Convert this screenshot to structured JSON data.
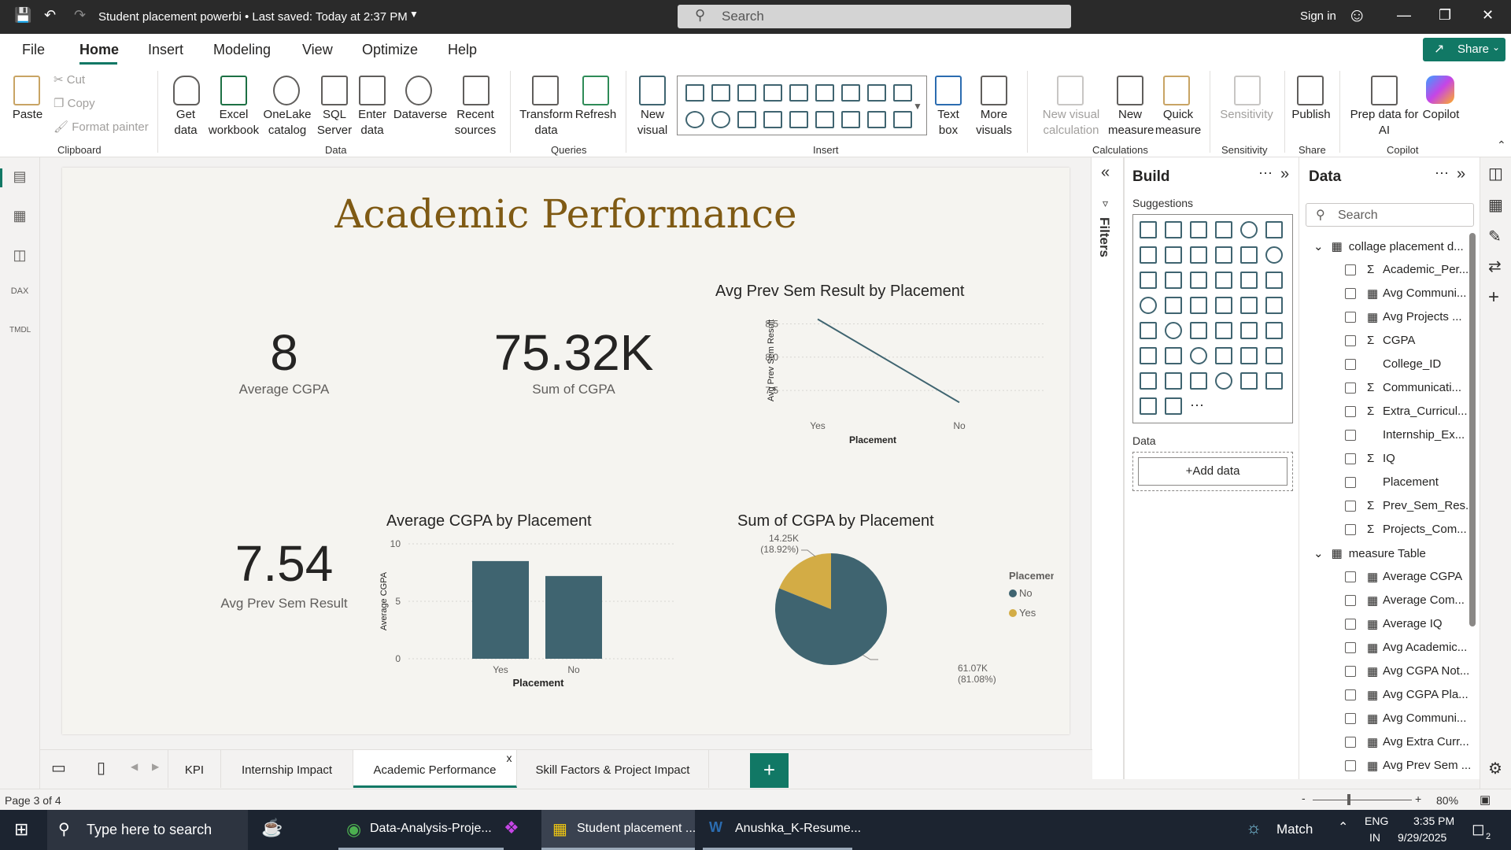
{
  "titlebar": {
    "doc_title": "Student placement powerbi • Last saved: Today at 2:37 PM",
    "search_placeholder": "Search",
    "signin": "Sign in"
  },
  "menu": {
    "items": [
      "File",
      "Home",
      "Insert",
      "Modeling",
      "View",
      "Optimize",
      "Help"
    ],
    "active": "Home",
    "share": "Share"
  },
  "ribbon": {
    "clipboard": {
      "paste": "Paste",
      "cut": "Cut",
      "copy": "Copy",
      "format_painter": "Format painter",
      "group": "Clipboard"
    },
    "data": {
      "get_data": "Get data",
      "excel": "Excel workbook",
      "onelake": "OneLake catalog",
      "sql": "SQL Server",
      "enter": "Enter data",
      "dataverse": "Dataverse",
      "recent": "Recent sources",
      "group": "Data"
    },
    "queries": {
      "transform": "Transform data",
      "refresh": "Refresh",
      "group": "Queries"
    },
    "insert": {
      "new_visual": "New visual",
      "text_box": "Text box",
      "more_visuals": "More visuals",
      "group": "Insert"
    },
    "calculations": {
      "new_visual_calc": "New visual calculation",
      "new_measure": "New measure",
      "quick_measure": "Quick measure",
      "group": "Calculations"
    },
    "sensitivity": {
      "label": "Sensitivity",
      "group": "Sensitivity"
    },
    "share": {
      "publish": "Publish",
      "group": "Share"
    },
    "copilot": {
      "prep": "Prep data for AI",
      "copilot": "Copilot",
      "group": "Copilot"
    }
  },
  "report": {
    "title": "Academic Performance",
    "kpis": [
      {
        "value": "8",
        "label": "Average CGPA"
      },
      {
        "value": "75.32K",
        "label": "Sum of CGPA"
      },
      {
        "value": "7.54",
        "label": "Avg Prev Sem Result"
      }
    ]
  },
  "chart_data": [
    {
      "type": "line",
      "title": "Avg Prev Sem Result by Placement",
      "xlabel": "Placement",
      "ylabel": "Avg Prev Sem Result",
      "categories": [
        "Yes",
        "No"
      ],
      "values": [
        8.57,
        7.32
      ],
      "yticks": [
        "8.5",
        "8.0",
        "7.5"
      ],
      "ylim": [
        7.3,
        8.6
      ],
      "color": "#3f6470"
    },
    {
      "type": "bar",
      "title": "Average CGPA by Placement",
      "xlabel": "Placement",
      "ylabel": "Average CGPA",
      "categories": [
        "Yes",
        "No"
      ],
      "values": [
        8.5,
        7.2
      ],
      "yticks": [
        "10",
        "5",
        "0"
      ],
      "ylim": [
        0,
        10
      ],
      "color": "#3f6470"
    },
    {
      "type": "pie",
      "title": "Sum of CGPA by Placement",
      "legend_title": "Placement",
      "slices": [
        {
          "name": "No",
          "value": 61.07,
          "label": "61.07K",
          "pct": "(81.08%)",
          "color": "#3f6470"
        },
        {
          "name": "Yes",
          "value": 14.25,
          "label": "14.25K",
          "pct": "(18.92%)",
          "color": "#d3ac45"
        }
      ]
    }
  ],
  "build": {
    "title": "Build",
    "suggestions": "Suggestions",
    "data_label": "Data",
    "add_data": "+Add data",
    "filters": "Filters"
  },
  "data_pane": {
    "title": "Data",
    "search_placeholder": "Search",
    "table1": "collage placement d...",
    "fields1": [
      {
        "name": "Academic_Per...",
        "sigma": true
      },
      {
        "name": "Avg Communi...",
        "calc": true
      },
      {
        "name": "Avg Projects ...",
        "calc": true
      },
      {
        "name": "CGPA",
        "sigma": true
      },
      {
        "name": "College_ID"
      },
      {
        "name": "Communicati...",
        "sigma": true
      },
      {
        "name": "Extra_Curricul...",
        "sigma": true
      },
      {
        "name": "Internship_Ex..."
      },
      {
        "name": "IQ",
        "sigma": true
      },
      {
        "name": "Placement"
      },
      {
        "name": "Prev_Sem_Res...",
        "sigma": true
      },
      {
        "name": "Projects_Com...",
        "sigma": true
      }
    ],
    "table2": "measure Table",
    "fields2": [
      "Average CGPA",
      "Average Com...",
      "Average IQ",
      "Avg Academic...",
      "Avg CGPA Not...",
      "Avg CGPA Pla...",
      "Avg Communi...",
      "Avg Extra Curr...",
      "Avg Prev Sem ..."
    ]
  },
  "tabs": {
    "items": [
      "KPI",
      "Internship Impact",
      "Academic Performance",
      "Skill Factors & Project Impact"
    ],
    "active": "Academic Performance",
    "close": "x",
    "add": "+"
  },
  "status": {
    "page": "Page 3 of 4",
    "zoom": "80%",
    "minus": "-",
    "plus": "+"
  },
  "taskbar": {
    "search": "Type here to search",
    "apps": [
      "Data-Analysis-Proje...",
      "Student placement ...",
      "Anushka_K-Resume..."
    ],
    "weather": "Match",
    "lang1": "ENG",
    "lang2": "IN",
    "time": "3:35 PM",
    "date": "9/29/2025",
    "notif": "2"
  }
}
